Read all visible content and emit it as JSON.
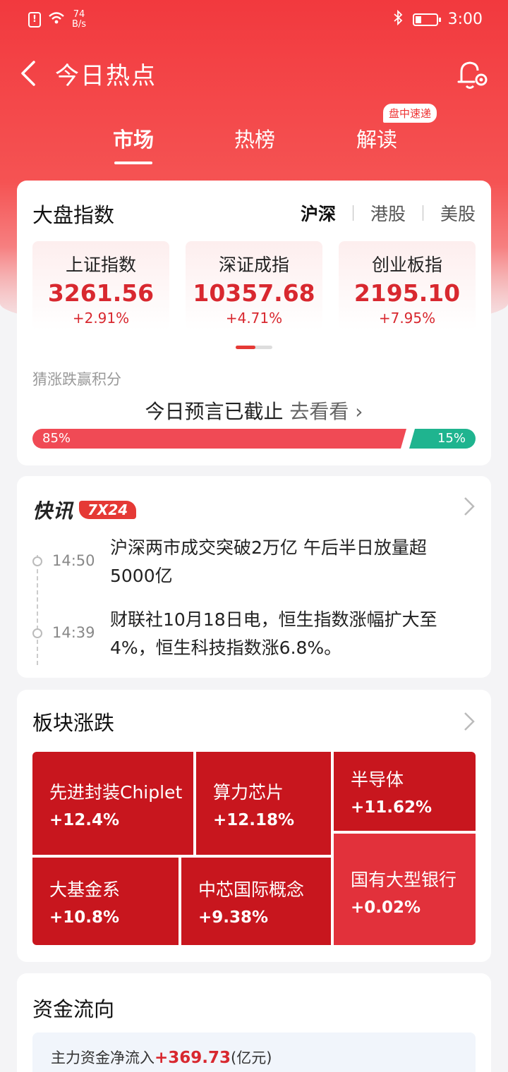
{
  "status_bar": {
    "speed_value": "74",
    "speed_unit": "B/s",
    "time": "3:00"
  },
  "header": {
    "title": "今日热点"
  },
  "tabs": [
    {
      "label": "市场",
      "active": true
    },
    {
      "label": "热榜",
      "active": false
    },
    {
      "label": "解读",
      "active": false
    }
  ],
  "tab_badge": "盘中速递",
  "indices": {
    "title": "大盘指数",
    "markets": [
      "沪深",
      "港股",
      "美股"
    ],
    "active_market": "沪深",
    "items": [
      {
        "name": "上证指数",
        "value": "3261.56",
        "change": "+2.91%"
      },
      {
        "name": "深证成指",
        "value": "10357.68",
        "change": "+4.71%"
      },
      {
        "name": "创业板指",
        "value": "2195.10",
        "change": "+7.95%"
      }
    ],
    "guess_label": "猜涨跌赢积分",
    "guess_text": "今日预言已截止",
    "guess_link": "去看看 ›",
    "up_percent_label": "85%",
    "down_percent_label": "15%",
    "up_fraction": 0.85,
    "colors": {
      "up": "#f04a55",
      "down": "#1fb48f"
    }
  },
  "news": {
    "logo_text": "快讯",
    "logo_tag": "7X24",
    "items": [
      {
        "time": "14:50",
        "text": "沪深两市成交突破2万亿 午后半日放量超5000亿"
      },
      {
        "time": "14:39",
        "text": "财联社10月18日电，恒生指数涨幅扩大至4%，恒生科技指数涨6.8%。"
      }
    ]
  },
  "sectors": {
    "title": "板块涨跌",
    "items": [
      {
        "name": "先进封装Chiplet",
        "change": "+12.4%",
        "color": "#c8161e"
      },
      {
        "name": "算力芯片",
        "change": "+12.18%",
        "color": "#c8161e"
      },
      {
        "name": "半导体",
        "change": "+11.62%",
        "color": "#c8161e"
      },
      {
        "name": "大基金系",
        "change": "+10.8%",
        "color": "#c8161e"
      },
      {
        "name": "中芯国际概念",
        "change": "+9.38%",
        "color": "#c8161e"
      },
      {
        "name": "国有大型银行",
        "change": "+0.02%",
        "color": "#e2313b"
      }
    ]
  },
  "fund_flow": {
    "title": "资金流向",
    "label": "主力资金净流入",
    "value": "+369.73",
    "unit": "(亿元)"
  }
}
